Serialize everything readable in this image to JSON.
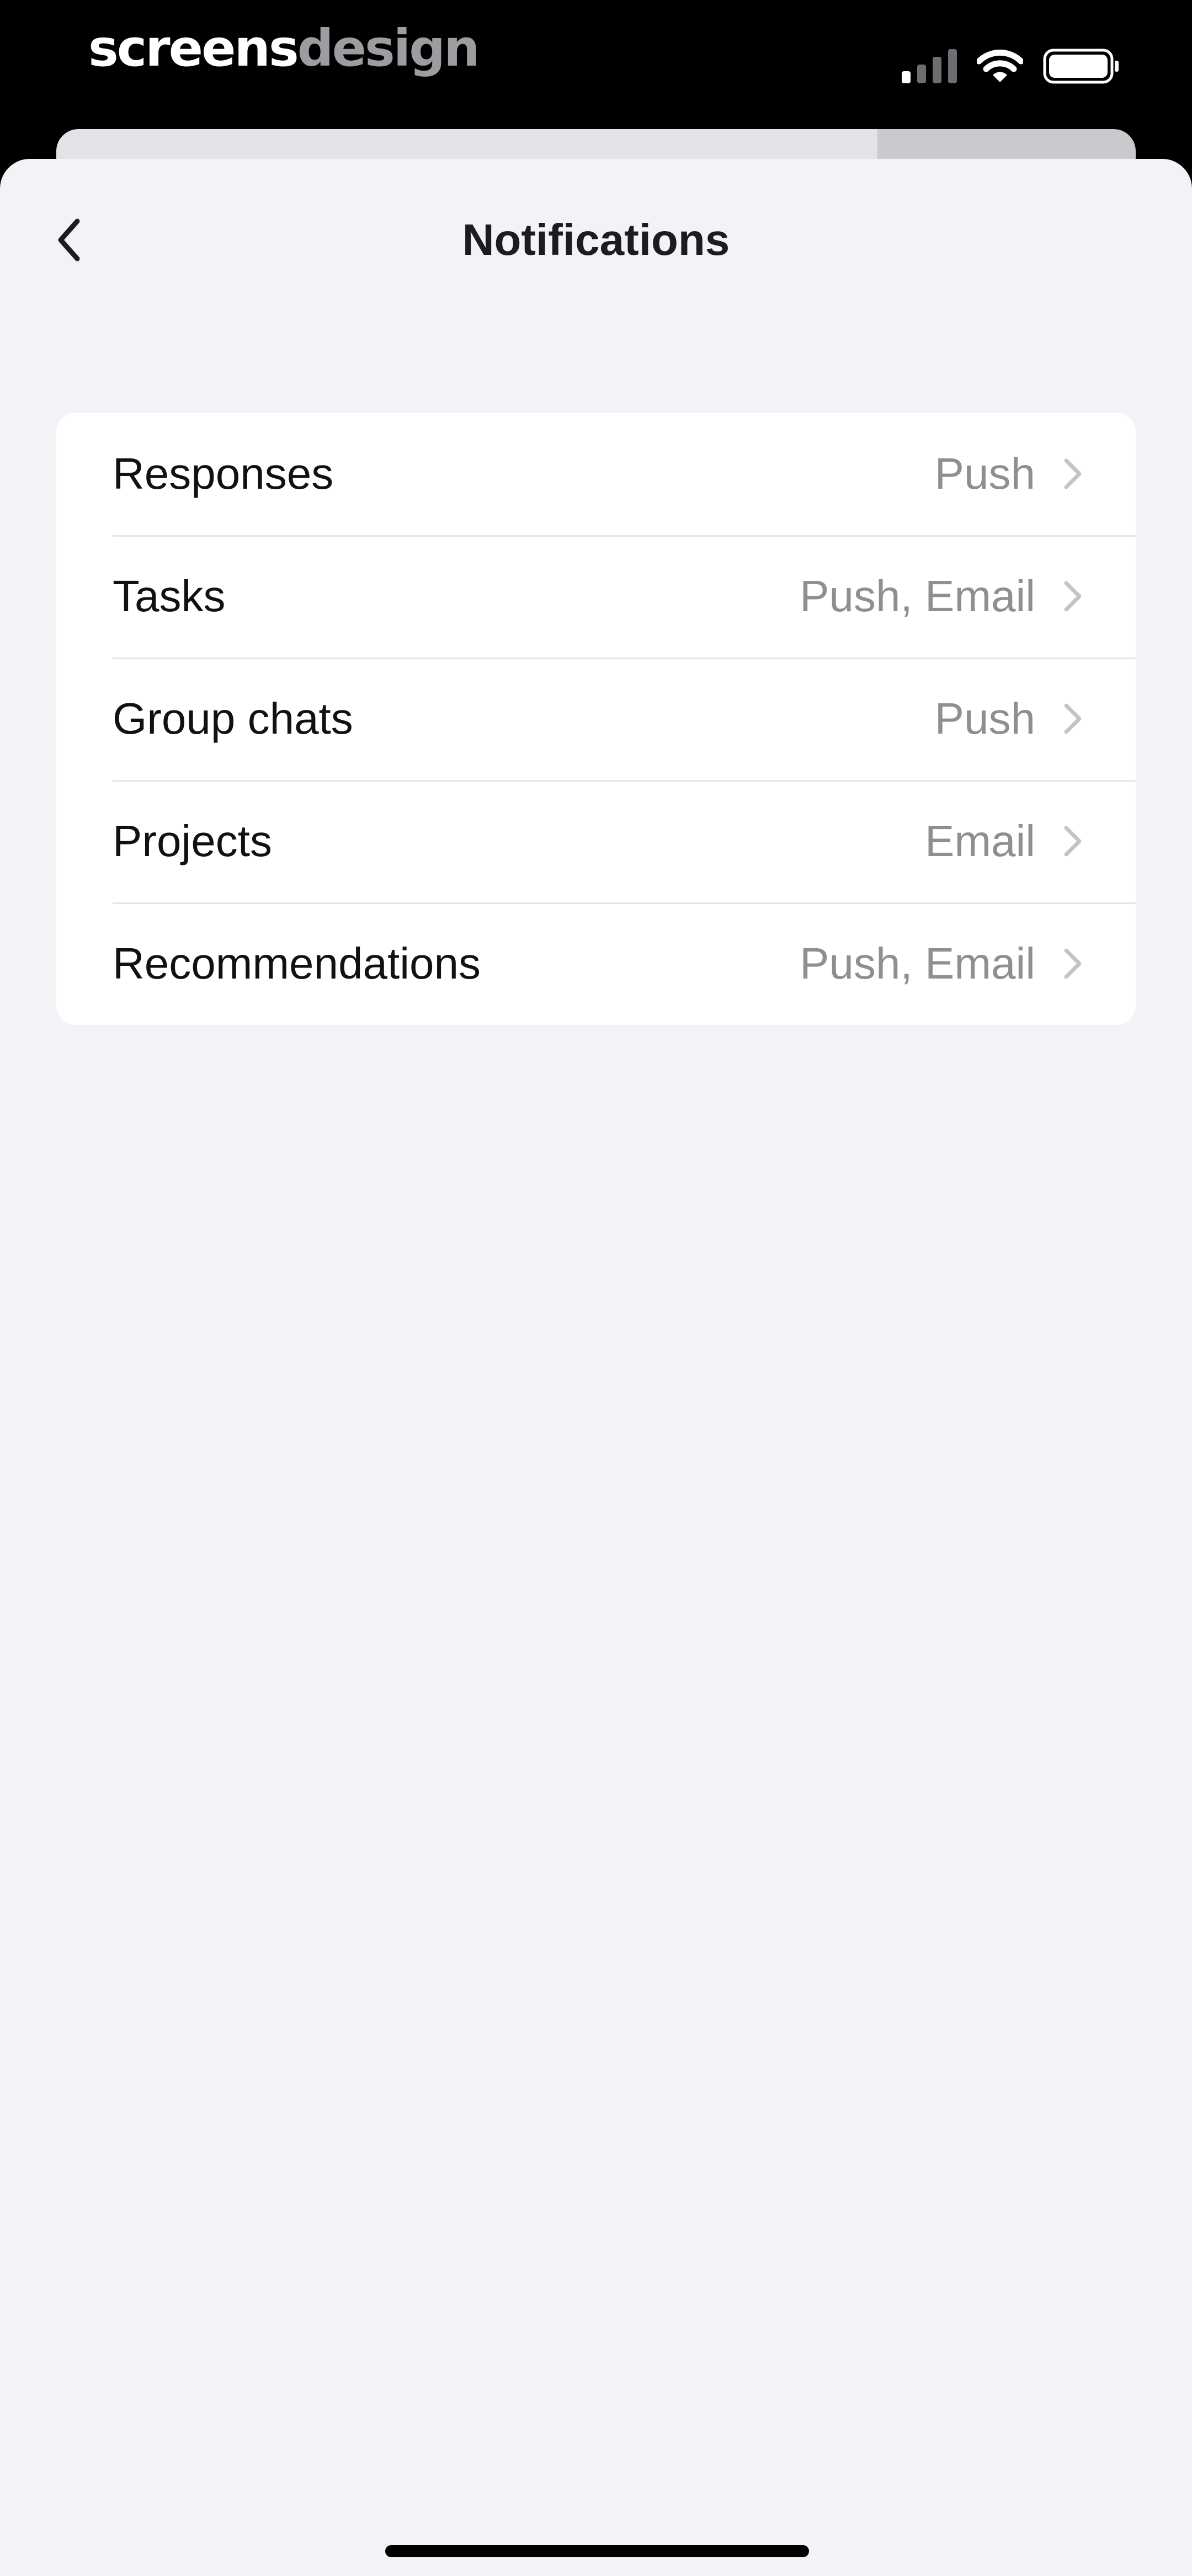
{
  "brand": {
    "part1": "screens",
    "part2": "design"
  },
  "status_bar": {
    "signal_icon": "cellular-signal-icon",
    "wifi_icon": "wifi-icon",
    "battery_icon": "battery-icon"
  },
  "header": {
    "title": "Notifications",
    "back_icon": "chevron-left-icon"
  },
  "settings": [
    {
      "label": "Responses",
      "value": "Push"
    },
    {
      "label": "Tasks",
      "value": "Push, Email"
    },
    {
      "label": "Group chats",
      "value": "Push"
    },
    {
      "label": "Projects",
      "value": "Email"
    },
    {
      "label": "Recommendations",
      "value": "Push, Email"
    }
  ],
  "colors": {
    "background": "#f2f2f7",
    "card": "#ffffff",
    "primary_text": "#111111",
    "secondary_text": "#8e8e93",
    "chevron": "#c4c4c7"
  }
}
